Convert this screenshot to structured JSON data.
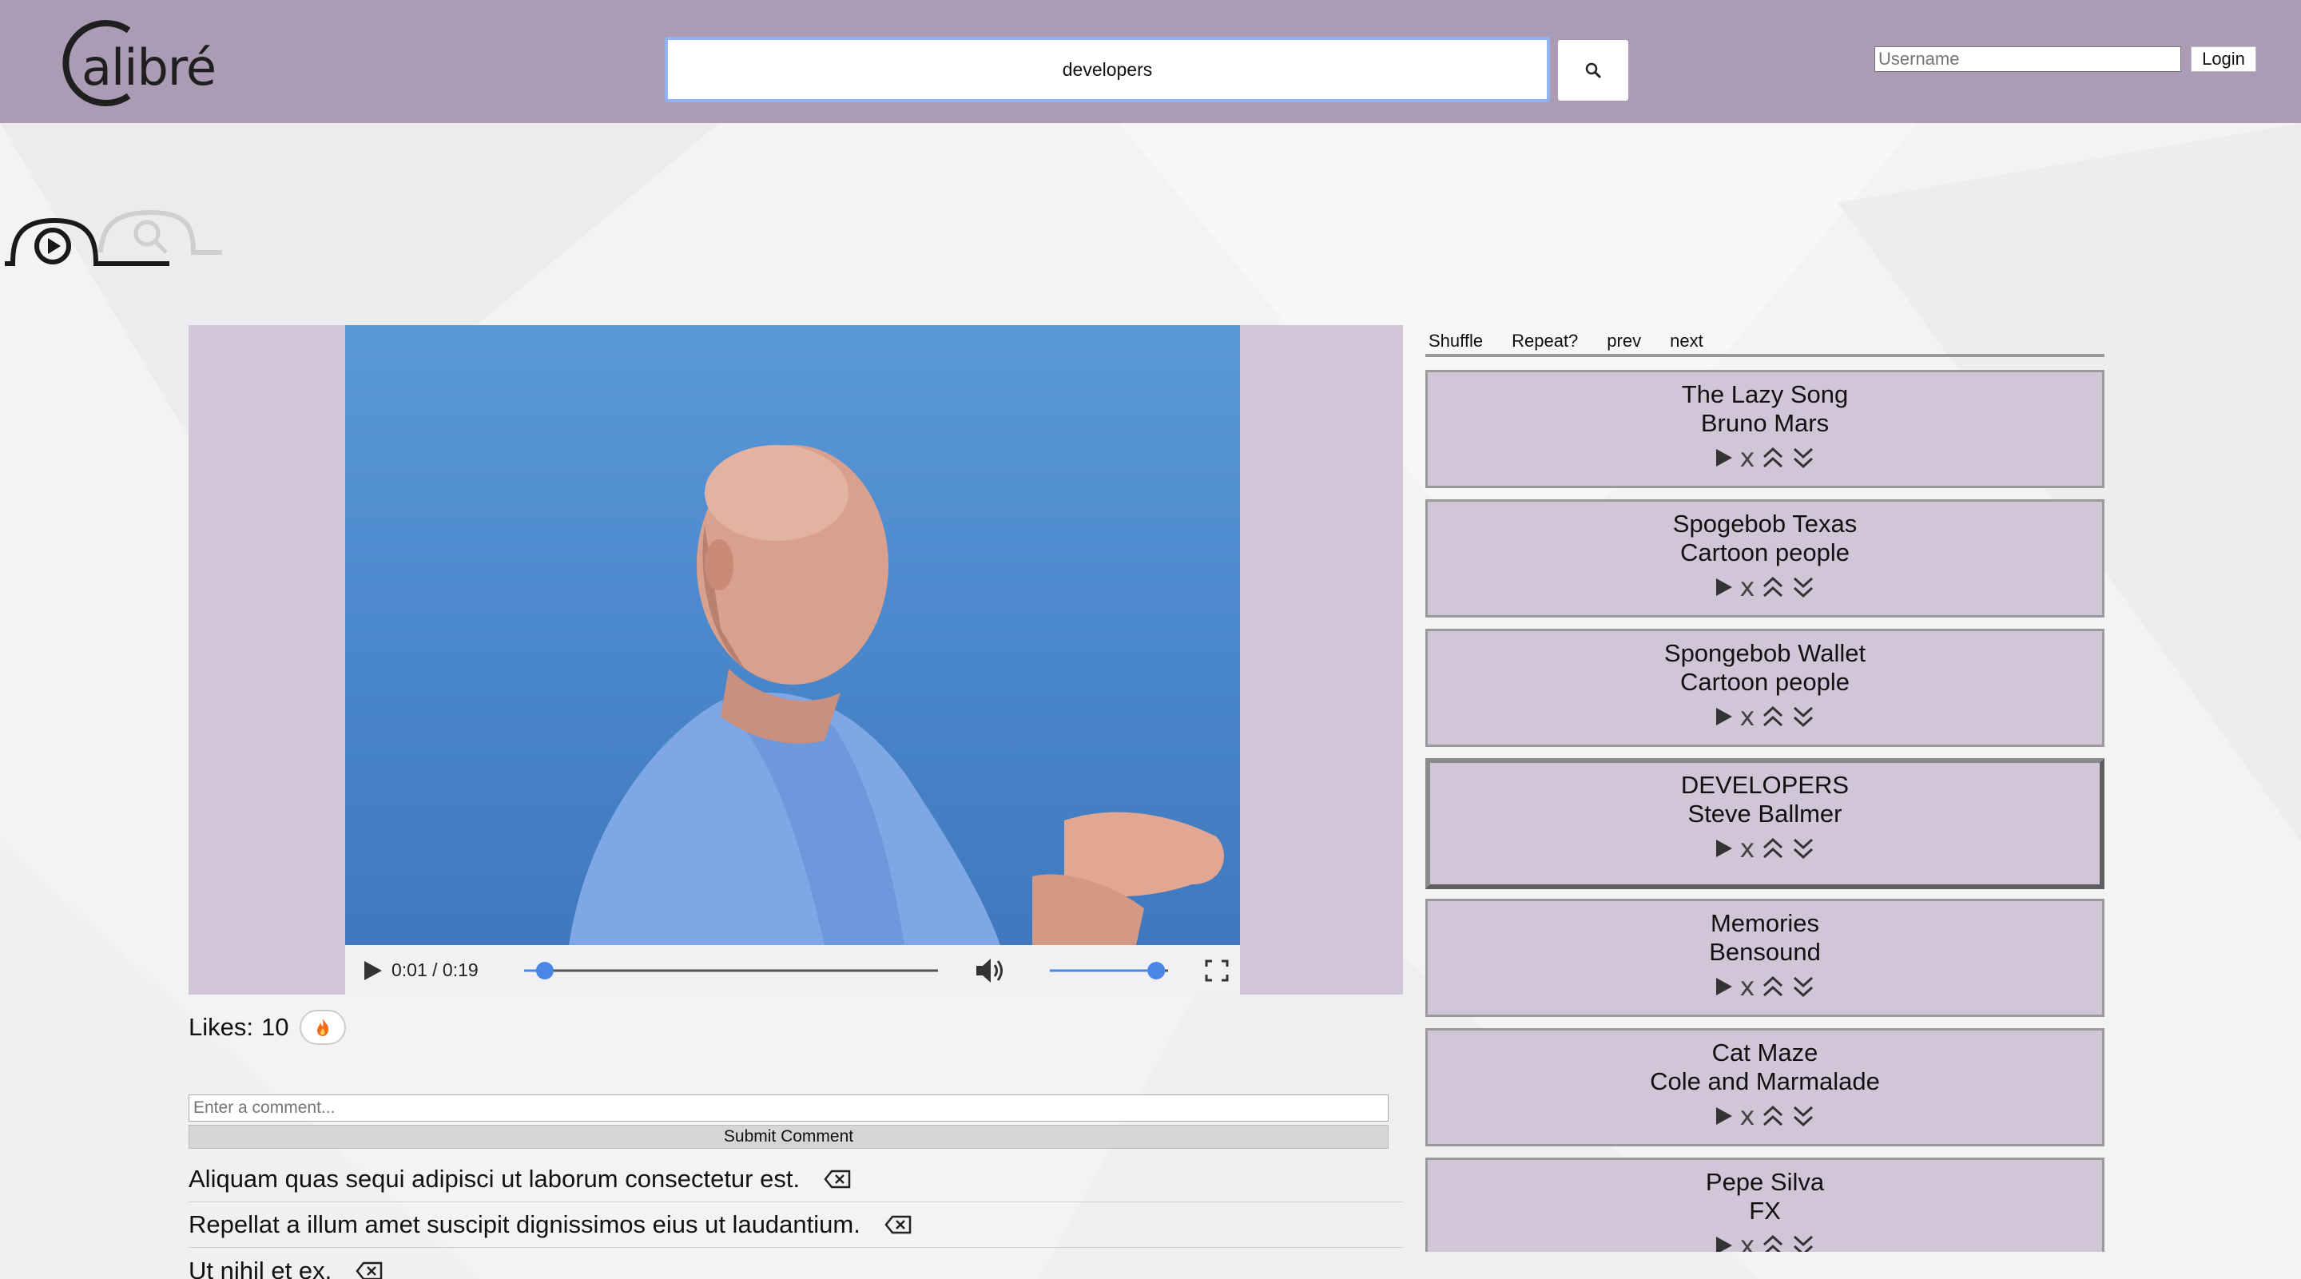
{
  "app": {
    "logo_text": "alibré"
  },
  "search": {
    "value": "developers"
  },
  "auth": {
    "username_placeholder": "Username",
    "login_label": "Login"
  },
  "player": {
    "time": "0:01 / 0:19",
    "progress": 0.05,
    "volume": 0.9
  },
  "likes": {
    "label": "Likes:",
    "count": "10"
  },
  "comment_form": {
    "placeholder": "Enter a comment...",
    "submit_label": "Submit Comment"
  },
  "comments": [
    {
      "text": "Aliquam quas sequi adipisci ut laborum consectetur est."
    },
    {
      "text": "Repellat a illum amet suscipit dignissimos eius ut laudantium."
    },
    {
      "text": "Ut nihil et ex."
    }
  ],
  "playlist_controls": {
    "shuffle": "Shuffle",
    "repeat": "Repeat?",
    "prev": "prev",
    "next": "next"
  },
  "playlist": [
    {
      "title": "The Lazy Song",
      "artist": "Bruno Mars",
      "active": false
    },
    {
      "title": "Spogebob Texas",
      "artist": "Cartoon people",
      "active": false
    },
    {
      "title": "Spongebob Wallet",
      "artist": "Cartoon people",
      "active": false
    },
    {
      "title": "DEVELOPERS",
      "artist": "Steve Ballmer",
      "active": true
    },
    {
      "title": "Memories",
      "artist": "Bensound",
      "active": false
    },
    {
      "title": "Cat Maze",
      "artist": "Cole and Marmalade",
      "active": false
    },
    {
      "title": "Pepe Silva",
      "artist": "FX",
      "active": false
    }
  ],
  "colors": {
    "header": "#ab9bb4",
    "card": "#d1c5d8",
    "accent": "#4a86e8"
  },
  "icons": [
    "search-icon",
    "play-icon",
    "volume-icon",
    "fullscreen-icon",
    "fire-icon",
    "backspace-icon",
    "chevron-up-double-icon",
    "chevron-down-double-icon"
  ]
}
